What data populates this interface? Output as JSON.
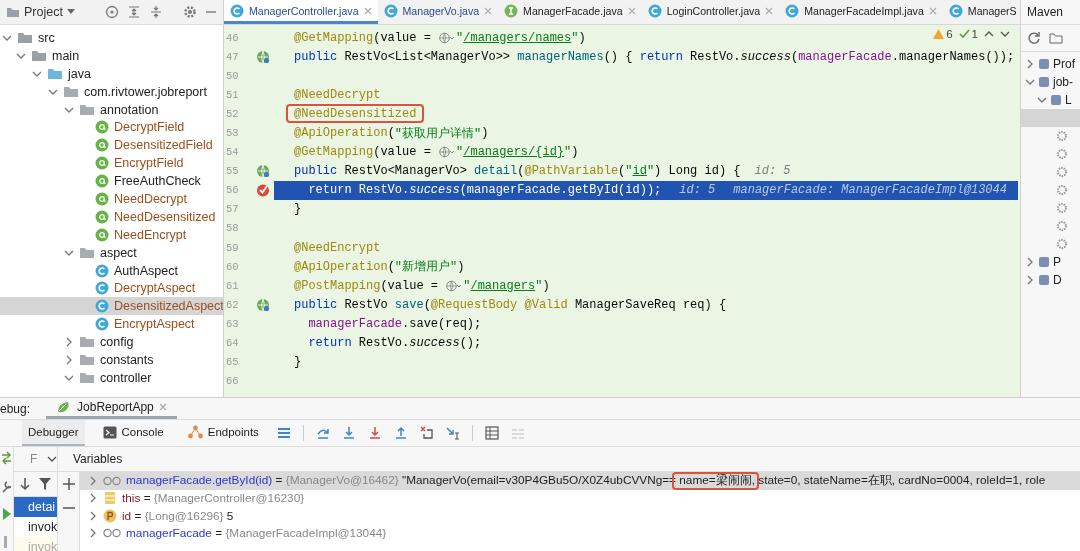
{
  "project": {
    "title": "Project",
    "tree": [
      {
        "label": "src",
        "kind": "folder",
        "expanded": true,
        "selected": false,
        "modified": false,
        "children": [
          {
            "label": "main",
            "kind": "folder",
            "expanded": true,
            "selected": false,
            "modified": false,
            "children": [
              {
                "label": "java",
                "kind": "source-folder",
                "expanded": true,
                "selected": false,
                "modified": false,
                "children": [
                  {
                    "label": "com.rivtower.jobreport",
                    "kind": "package",
                    "expanded": true,
                    "selected": false,
                    "modified": false,
                    "children": [
                      {
                        "label": "annotation",
                        "kind": "package",
                        "expanded": true,
                        "selected": false,
                        "modified": false,
                        "children": [
                          {
                            "label": "DecryptField",
                            "kind": "annotation",
                            "selected": false,
                            "modified": true
                          },
                          {
                            "label": "DesensitizedField",
                            "kind": "annotation",
                            "selected": false,
                            "modified": true
                          },
                          {
                            "label": "EncryptField",
                            "kind": "annotation",
                            "selected": false,
                            "modified": true
                          },
                          {
                            "label": "FreeAuthCheck",
                            "kind": "annotation",
                            "selected": false,
                            "modified": false
                          },
                          {
                            "label": "NeedDecrypt",
                            "kind": "annotation",
                            "selected": false,
                            "modified": true
                          },
                          {
                            "label": "NeedDesensitized",
                            "kind": "annotation",
                            "selected": false,
                            "modified": true
                          },
                          {
                            "label": "NeedEncrypt",
                            "kind": "annotation",
                            "selected": false,
                            "modified": true
                          }
                        ]
                      },
                      {
                        "label": "aspect",
                        "kind": "package",
                        "expanded": true,
                        "selected": false,
                        "modified": false,
                        "children": [
                          {
                            "label": "AuthAspect",
                            "kind": "class",
                            "selected": false,
                            "modified": false
                          },
                          {
                            "label": "DecryptAspect",
                            "kind": "class",
                            "selected": false,
                            "modified": true
                          },
                          {
                            "label": "DesensitizedAspect",
                            "kind": "class",
                            "selected": true,
                            "modified": true
                          },
                          {
                            "label": "EncryptAspect",
                            "kind": "class",
                            "selected": false,
                            "modified": true
                          }
                        ]
                      },
                      {
                        "label": "config",
                        "kind": "package",
                        "expanded": false,
                        "selected": false,
                        "modified": false
                      },
                      {
                        "label": "constants",
                        "kind": "package",
                        "expanded": false,
                        "selected": false,
                        "modified": false
                      },
                      {
                        "label": "controller",
                        "kind": "package",
                        "expanded": true,
                        "selected": false,
                        "modified": false
                      }
                    ]
                  }
                ]
              }
            ]
          }
        ]
      }
    ]
  },
  "editor": {
    "tabs": [
      {
        "label": "ManagerController.java",
        "kind": "class",
        "selected": true,
        "modified": true
      },
      {
        "label": "ManagerVo.java",
        "kind": "class",
        "selected": false,
        "modified": true
      },
      {
        "label": "ManagerFacade.java",
        "kind": "interface",
        "selected": false,
        "modified": false
      },
      {
        "label": "LoginController.java",
        "kind": "class",
        "selected": false,
        "modified": false
      },
      {
        "label": "ManagerFacadeImpl.java",
        "kind": "class",
        "selected": false,
        "modified": false
      },
      {
        "label": "ManagerS",
        "kind": "class",
        "selected": false,
        "modified": false
      }
    ],
    "inspections": {
      "warnings": "6",
      "weak_warnings": "1"
    },
    "lines": [
      {
        "number": "46",
        "current": false,
        "tokens": [
          {
            "kind": "annotation",
            "text": "@GetMapping"
          },
          {
            "kind": "plain",
            "text": "(value = "
          },
          {
            "kind": "globe"
          },
          {
            "kind": "string",
            "text": "\""
          },
          {
            "kind": "link",
            "text": "/managers/names"
          },
          {
            "kind": "string",
            "text": "\""
          },
          {
            "kind": "plain",
            "text": ")"
          }
        ]
      },
      {
        "number": "47",
        "current": false,
        "gutter": {
          "kind": "run"
        },
        "tokens": [
          {
            "kind": "keyword",
            "text": "public "
          },
          {
            "kind": "plain",
            "text": "RestVo<List<ManagerVo>> "
          },
          {
            "kind": "method",
            "text": "managerNames"
          },
          {
            "kind": "plain",
            "text": "() { "
          },
          {
            "kind": "keyword",
            "text": "return "
          },
          {
            "kind": "plain",
            "text": "RestVo."
          },
          {
            "kind": "italic",
            "text": "success"
          },
          {
            "kind": "plain",
            "text": "("
          },
          {
            "kind": "field",
            "text": "managerFacade"
          },
          {
            "kind": "plain",
            "text": ".managerNames());"
          }
        ]
      },
      {
        "number": "50",
        "current": false
      },
      {
        "number": "51",
        "current": false,
        "tokens": [
          {
            "kind": "annotation",
            "text": "@NeedDecrypt"
          }
        ]
      },
      {
        "number": "52",
        "current": false,
        "tokens": [
          {
            "kind": "annotation",
            "text": "@NeedDesensitized",
            "boxed": true
          }
        ]
      },
      {
        "number": "53",
        "current": false,
        "tokens": [
          {
            "kind": "annotation",
            "text": "@ApiOperation"
          },
          {
            "kind": "plain",
            "text": "("
          },
          {
            "kind": "string",
            "text": "\"获取用户详情\""
          },
          {
            "kind": "plain",
            "text": ")"
          }
        ]
      },
      {
        "number": "54",
        "current": false,
        "tokens": [
          {
            "kind": "annotation",
            "text": "@GetMapping"
          },
          {
            "kind": "plain",
            "text": "(value = "
          },
          {
            "kind": "globe"
          },
          {
            "kind": "string",
            "text": "\""
          },
          {
            "kind": "link",
            "text": "/managers/{id}"
          },
          {
            "kind": "string",
            "text": "\""
          },
          {
            "kind": "plain",
            "text": ")"
          }
        ]
      },
      {
        "number": "55",
        "current": false,
        "gutter": {
          "kind": "run"
        },
        "tokens": [
          {
            "kind": "keyword",
            "text": "public "
          },
          {
            "kind": "plain",
            "text": "RestVo<ManagerVo> "
          },
          {
            "kind": "method",
            "text": "detail"
          },
          {
            "kind": "plain",
            "text": "("
          },
          {
            "kind": "annotation",
            "text": "@PathVariable"
          },
          {
            "kind": "plain",
            "text": "("
          },
          {
            "kind": "string",
            "text": "\""
          },
          {
            "kind": "link",
            "text": "id"
          },
          {
            "kind": "string",
            "text": "\""
          },
          {
            "kind": "plain",
            "text": ") Long id) {"
          },
          {
            "kind": "hint",
            "text": "id: 5"
          }
        ]
      },
      {
        "number": "56",
        "current": true,
        "gutter": {
          "kind": "breakpoint"
        },
        "tokens": [
          {
            "kind": "keyword",
            "text": "  return "
          },
          {
            "kind": "plain",
            "text": "RestVo."
          },
          {
            "kind": "italic",
            "text": "success"
          },
          {
            "kind": "plain",
            "text": "(managerFacade.getById(id));"
          },
          {
            "kind": "hint",
            "text": "id: 5"
          },
          {
            "kind": "hint",
            "text": "managerFacade: ManagerFacadeImpl@13044"
          }
        ]
      },
      {
        "number": "57",
        "current": false,
        "tokens": [
          {
            "kind": "plain",
            "text": "}"
          }
        ]
      },
      {
        "number": "58",
        "current": false
      },
      {
        "number": "59",
        "current": false,
        "tokens": [
          {
            "kind": "annotation",
            "text": "@NeedEncrypt"
          }
        ]
      },
      {
        "number": "60",
        "current": false,
        "tokens": [
          {
            "kind": "annotation",
            "text": "@ApiOperation"
          },
          {
            "kind": "plain",
            "text": "("
          },
          {
            "kind": "string",
            "text": "\"新增用户\""
          },
          {
            "kind": "plain",
            "text": ")"
          }
        ]
      },
      {
        "number": "61",
        "current": false,
        "tokens": [
          {
            "kind": "annotation",
            "text": "@PostMapping"
          },
          {
            "kind": "plain",
            "text": "(value = "
          },
          {
            "kind": "globe"
          },
          {
            "kind": "string",
            "text": "\""
          },
          {
            "kind": "link",
            "text": "/managers"
          },
          {
            "kind": "string",
            "text": "\""
          },
          {
            "kind": "plain",
            "text": ")"
          }
        ]
      },
      {
        "number": "62",
        "current": false,
        "gutter": {
          "kind": "run"
        },
        "tokens": [
          {
            "kind": "keyword",
            "text": "public "
          },
          {
            "kind": "plain",
            "text": "RestVo "
          },
          {
            "kind": "method",
            "text": "save"
          },
          {
            "kind": "plain",
            "text": "("
          },
          {
            "kind": "annotation",
            "text": "@RequestBody @Valid"
          },
          {
            "kind": "plain",
            "text": " ManagerSaveReq req) {"
          }
        ]
      },
      {
        "number": "63",
        "current": false,
        "tokens": [
          {
            "kind": "field",
            "text": "  managerFacade"
          },
          {
            "kind": "plain",
            "text": ".save(req);"
          }
        ]
      },
      {
        "number": "64",
        "current": false,
        "tokens": [
          {
            "kind": "keyword",
            "text": "  return "
          },
          {
            "kind": "plain",
            "text": "RestVo."
          },
          {
            "kind": "italic",
            "text": "success"
          },
          {
            "kind": "plain",
            "text": "();"
          }
        ]
      },
      {
        "number": "65",
        "current": false,
        "tokens": [
          {
            "kind": "plain",
            "text": "}"
          }
        ]
      },
      {
        "number": "66",
        "current": false
      }
    ]
  },
  "maven": {
    "title": "Maven",
    "items": [
      {
        "label": "Prof",
        "expanded": false
      },
      {
        "label": "job-",
        "expanded": true,
        "children": [
          {
            "label": "L",
            "expanded": true
          }
        ]
      },
      {
        "label": "P",
        "expanded": false
      },
      {
        "label": "D",
        "expanded": false
      }
    ]
  },
  "debug": {
    "label": "ebug:",
    "sessions": [
      {
        "label": "JobReportApp",
        "selected": true
      }
    ],
    "tabs": [
      {
        "label": "Debugger",
        "kind": "debugger",
        "selected": true
      },
      {
        "label": "Console",
        "kind": "console",
        "selected": false
      },
      {
        "label": "Endpoints",
        "kind": "endpoints",
        "selected": false
      }
    ],
    "frames": {
      "header": "F",
      "items": [
        {
          "label": "detai",
          "selected": true,
          "dimmed": false
        },
        {
          "label": "invok",
          "selected": false,
          "dimmed": false
        },
        {
          "label": "invok",
          "selected": false,
          "dimmed": true
        }
      ]
    },
    "variables": {
      "title": "Variables",
      "rows": [
        {
          "kind": "watch",
          "name": "managerFacade.getById(id)",
          "selected": true,
          "value": [
            {
              "kind": "text",
              "text": " = "
            },
            {
              "kind": "ref",
              "text": "{ManagerVo@16462}"
            },
            {
              "kind": "text",
              "text": " \"ManagerVo(email=v30P4GBu5O/X0Z4ubCVVNg=="
            },
            {
              "kind": "text",
              "text": " name=梁闹闹,",
              "boxed": true
            },
            {
              "kind": "text",
              "text": " state=0, stateName=在职, cardNo=0004, roleId=1, role"
            }
          ]
        },
        {
          "kind": "field",
          "name": "this",
          "selected": false,
          "value": [
            {
              "kind": "text",
              "text": " = "
            },
            {
              "kind": "ref",
              "text": "{ManagerController@16230}"
            }
          ]
        },
        {
          "kind": "param",
          "name": "id",
          "selected": false,
          "value": [
            {
              "kind": "text",
              "text": " = "
            },
            {
              "kind": "ref",
              "text": "{Long@16296}"
            },
            {
              "kind": "text",
              "text": " 5"
            }
          ]
        },
        {
          "kind": "watch",
          "name": "managerFacade",
          "selected": false,
          "value": [
            {
              "kind": "text",
              "text": " = "
            },
            {
              "kind": "ref",
              "text": "{ManagerFacadeImpl@13044}"
            }
          ]
        }
      ]
    }
  }
}
